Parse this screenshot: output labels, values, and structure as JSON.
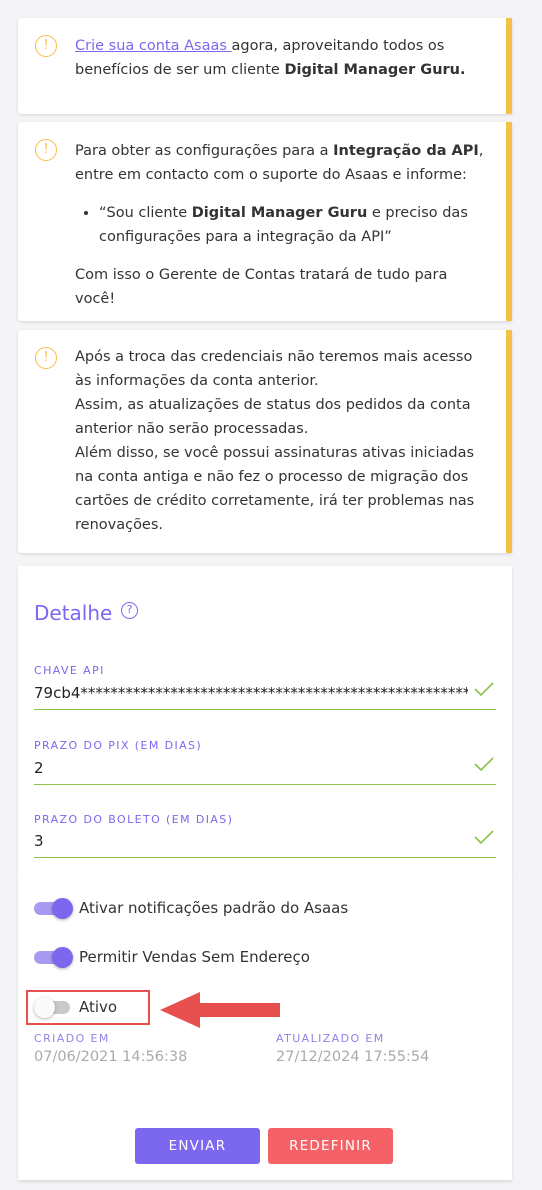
{
  "alerts": {
    "signup": {
      "link": "Crie sua conta Asaas ",
      "text1": "agora, aproveitando todos os benefícios de ser um cliente ",
      "bold": "Digital Manager Guru."
    },
    "integration": {
      "text1": "Para obter as configurações para a ",
      "bold1": "Integração da API",
      "text2": ", entre em contacto com o suporte do Asaas e informe:",
      "bullet_text1": "“Sou cliente ",
      "bullet_bold": "Digital Manager Guru",
      "bullet_text2": " e preciso das configurações para a integração da API”",
      "footer": "Com isso o Gerente de Contas tratará de tudo para você!"
    },
    "warning": {
      "line1": "Após a troca das credenciais não teremos mais acesso às informações da conta anterior.",
      "line2": "Assim, as atualizações de status dos pedidos da conta anterior não serão processadas.",
      "line3": "Além disso, se você possui assinaturas ativas iniciadas na conta antiga e não fez o processo de migração dos cartões de crédito corretamente, irá ter problemas nas renovações."
    }
  },
  "detail": {
    "title": "Detalhe",
    "help_icon": "?",
    "fields": [
      {
        "label": "CHAVE API",
        "value": "79cb4**************************************************************"
      },
      {
        "label": "PRAZO DO PIX (EM DIAS)",
        "value": "2"
      },
      {
        "label": "PRAZO DO BOLETO (EM DIAS)",
        "value": "3"
      }
    ],
    "toggles": [
      {
        "label": "Ativar notificações padrão do Asaas",
        "on": true
      },
      {
        "label": "Permitir Vendas Sem Endereço",
        "on": true
      },
      {
        "label": "Ativo",
        "on": false
      }
    ],
    "created": {
      "label": "CRIADO EM",
      "value": "07/06/2021 14:56:38"
    },
    "updated": {
      "label": "ATUALIZADO EM",
      "value": "27/12/2024 17:55:54"
    }
  },
  "actions": {
    "send": "ENVIAR",
    "reset": "REDEFINIR"
  },
  "colors": {
    "accent": "#7b68ee",
    "warning": "#f6bf45",
    "valid": "#8bc34a",
    "danger": "#f46167",
    "annotation": "#e8504f"
  }
}
